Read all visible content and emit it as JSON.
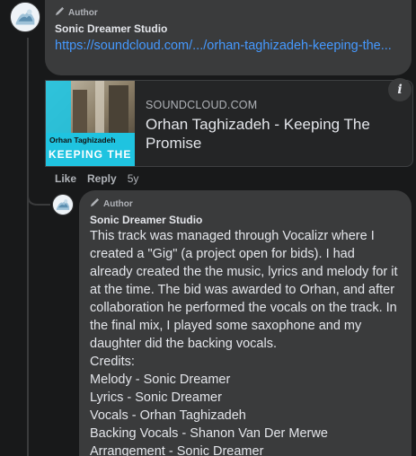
{
  "comment": {
    "author_badge": "Author",
    "name": "Sonic Dreamer Studio",
    "link_text": "https://soundcloud.com/.../orhan-taghizadeh-keeping-the..."
  },
  "preview": {
    "domain": "SOUNDCLOUD.COM",
    "title": "Orhan Taghizadeh - Keeping The Promise",
    "thumb_artist": "Orhan Taghizadeh",
    "thumb_title": "KEEPING THE"
  },
  "info_button": "i",
  "actions": {
    "like": "Like",
    "reply": "Reply",
    "time": "5y"
  },
  "reply": {
    "author_badge": "Author",
    "name": "Sonic Dreamer Studio",
    "body": "This track was managed through Vocalizr where I created a \"Gig\" (a project open for bids). I had already created the the music, lyrics and melody for it at the time. The bid was awarded to Orhan, and after collaboration he performed the vocals on the track. In the final mix, I played some saxophone and my daughter did the backing vocals.",
    "credits_heading": "Credits:",
    "credits": [
      "Melody - Sonic Dreamer",
      "Lyrics - Sonic Dreamer",
      "Vocals - Orhan Taghizadeh",
      "Backing Vocals - Shanon Van Der Merwe",
      "Arrangement - Sonic Dreamer"
    ]
  },
  "colors": {
    "background": "#18191a",
    "bubble": "#3a3b3c",
    "link": "#4599ff",
    "accent_cyan": "#1fc3e0"
  }
}
